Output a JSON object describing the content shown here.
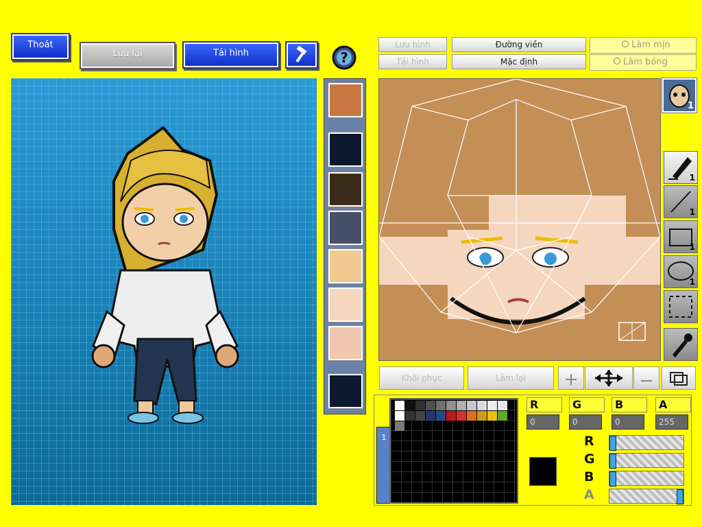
{
  "top_bar": {
    "exit_label": "Thoát",
    "save_label": "Lưu lại",
    "reload_label": "Tải hình",
    "hammer_icon": "hammer-icon",
    "help_icon": "question-icon"
  },
  "editor_toolbar": {
    "save_image_label": "Lưu hình",
    "load_image_label": "Tải hình",
    "outline_label": "Đường viền",
    "default_label": "Mặc định",
    "smooth_label": "Làm mịn",
    "shade_label": "Làm bóng"
  },
  "part_slots": [
    "hair-face-thumb",
    "empty",
    "hair-thumb",
    "shirt-thumb",
    "eyes-thumb",
    "face-thumb",
    "face-blush-thumb",
    "empty"
  ],
  "tools": {
    "pen_count": "1",
    "line_count": "1",
    "rect_count": "1",
    "ellipse_count": "1",
    "avatar_badge": "1"
  },
  "bottom_controls": {
    "restore_label": "Khôi phục",
    "redo_label": "Làm lại"
  },
  "color": {
    "r_label": "R",
    "g_label": "G",
    "b_label": "B",
    "a_label": "A",
    "r_value": "0",
    "g_value": "0",
    "b_value": "0",
    "a_value": "255",
    "current": "#000000",
    "palette_tab": "1",
    "r_level": 0,
    "g_level": 0,
    "b_level": 0,
    "a_level": 1
  },
  "palette_row1": [
    "#ffffff",
    "#101010",
    "#303030",
    "#505050",
    "#707070",
    "#909090",
    "#b0b0b0",
    "#c8c8c8",
    "#dcdcdc",
    "#eeeeee"
  ],
  "palette_row2": [
    "#e6e6e6",
    "#ffffff",
    "#333333",
    "#444444",
    "#223a6a",
    "#244a8a",
    "#c01818",
    "#d83030",
    "#e07018",
    "#c8a010"
  ],
  "palette_row3": [
    "#f0c010",
    "#60a828",
    "#7a7a7a"
  ]
}
